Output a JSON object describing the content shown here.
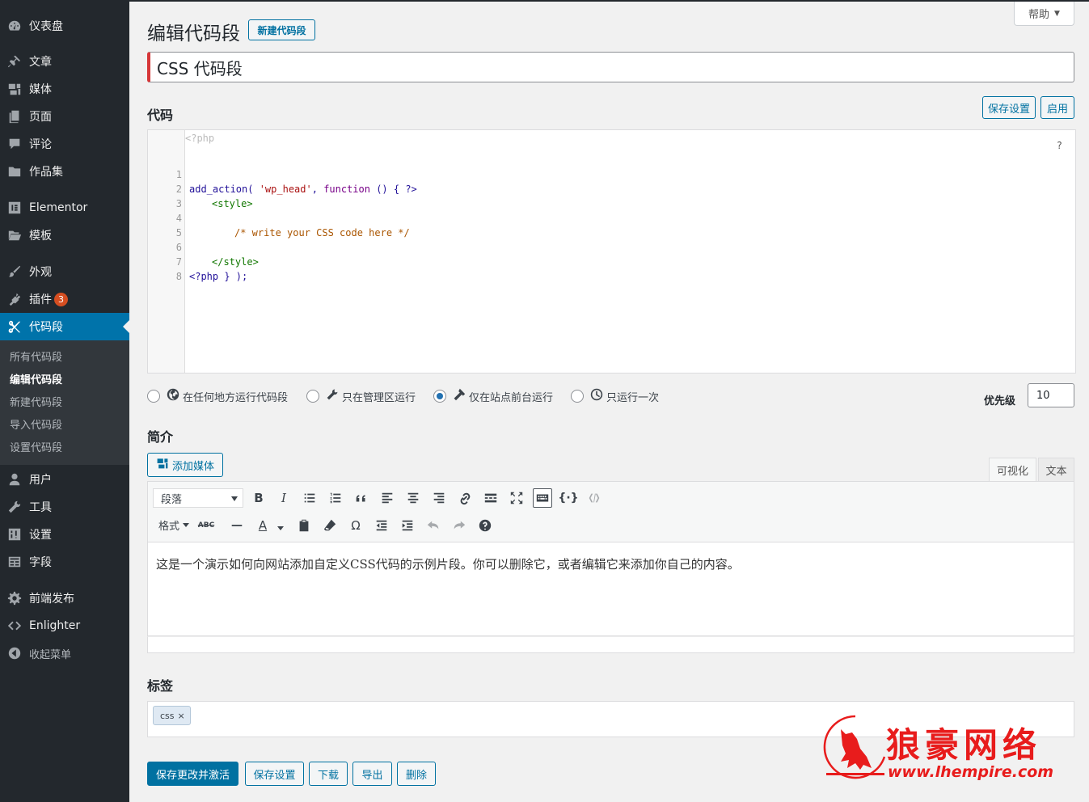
{
  "sidebar": {
    "items": [
      {
        "label": "仪表盘",
        "icon": "dashboard-icon"
      },
      {
        "label": "文章",
        "icon": "pin-icon"
      },
      {
        "label": "媒体",
        "icon": "media-icon"
      },
      {
        "label": "页面",
        "icon": "page-icon"
      },
      {
        "label": "评论",
        "icon": "comment-icon"
      },
      {
        "label": "作品集",
        "icon": "folder-icon"
      },
      {
        "label": "Elementor",
        "icon": "elementor-icon"
      },
      {
        "label": "模板",
        "icon": "folder-open-icon"
      },
      {
        "label": "外观",
        "icon": "brush-icon"
      },
      {
        "label": "插件",
        "icon": "plugin-icon",
        "badge": "3"
      },
      {
        "label": "代码段",
        "icon": "scissors-icon"
      },
      {
        "label": "用户",
        "icon": "user-icon"
      },
      {
        "label": "工具",
        "icon": "wrench-icon"
      },
      {
        "label": "设置",
        "icon": "settings-icon"
      },
      {
        "label": "字段",
        "icon": "fields-icon"
      },
      {
        "label": "前端发布",
        "icon": "gear-icon"
      },
      {
        "label": "Enlighter",
        "icon": "code-icon"
      },
      {
        "label": "收起菜单",
        "icon": "collapse-icon"
      }
    ],
    "submenu": [
      "所有代码段",
      "编辑代码段",
      "新建代码段",
      "导入代码段",
      "设置代码段"
    ]
  },
  "header": {
    "title": "编辑代码段",
    "new_button": "新建代码段",
    "help": "帮助"
  },
  "snippet_title": "CSS 代码段",
  "code": {
    "heading": "代码",
    "save_button": "保存设置",
    "activate_button": "启用",
    "php_open": "<?php",
    "help_mark": "?",
    "lines": [
      {
        "n": "1"
      },
      {
        "n": "2"
      },
      {
        "n": "3"
      },
      {
        "n": "4"
      },
      {
        "n": "5"
      },
      {
        "n": "6"
      },
      {
        "n": "7"
      },
      {
        "n": "8"
      }
    ],
    "line1": {
      "a": "add_action( ",
      "b": "'wp_head'",
      "c": ", ",
      "d": "function",
      "e": " () { ?>"
    },
    "line2": "<style>",
    "line4": "/* write your CSS code here */",
    "line6": "</style>",
    "line7": "<?php } );"
  },
  "scope": {
    "options": [
      {
        "label": "在任何地方运行代码段",
        "icon": "globe-icon",
        "checked": false
      },
      {
        "label": "只在管理区运行",
        "icon": "wrench-icon",
        "checked": false
      },
      {
        "label": "仅在站点前台运行",
        "icon": "hammer-icon",
        "checked": true
      },
      {
        "label": "只运行一次",
        "icon": "clock-icon",
        "checked": false
      }
    ],
    "priority_label": "优先级",
    "priority_value": "10"
  },
  "description": {
    "heading": "简介",
    "add_media": "添加媒体",
    "tab_visual": "可视化",
    "tab_text": "文本",
    "paragraph_select": "段落",
    "format_menu": "格式",
    "content": "这是一个演示如何向网站添加自定义CSS代码的示例片段。你可以删除它，或者编辑它来添加你自己的内容。"
  },
  "tags": {
    "heading": "标签",
    "items": [
      "css"
    ],
    "remove_mark": "×"
  },
  "actions": {
    "save_activate": "保存更改并激活",
    "save": "保存设置",
    "download": "下载",
    "export": "导出",
    "delete": "删除"
  },
  "watermark": {
    "title": "狼豪网络",
    "url": "www.lhempire.com"
  },
  "colors": {
    "sidebar_bg": "#23282d",
    "active": "#0073aa",
    "primary": "#0071a1",
    "badge": "#d54e21",
    "watermark": "#e81c1c"
  }
}
